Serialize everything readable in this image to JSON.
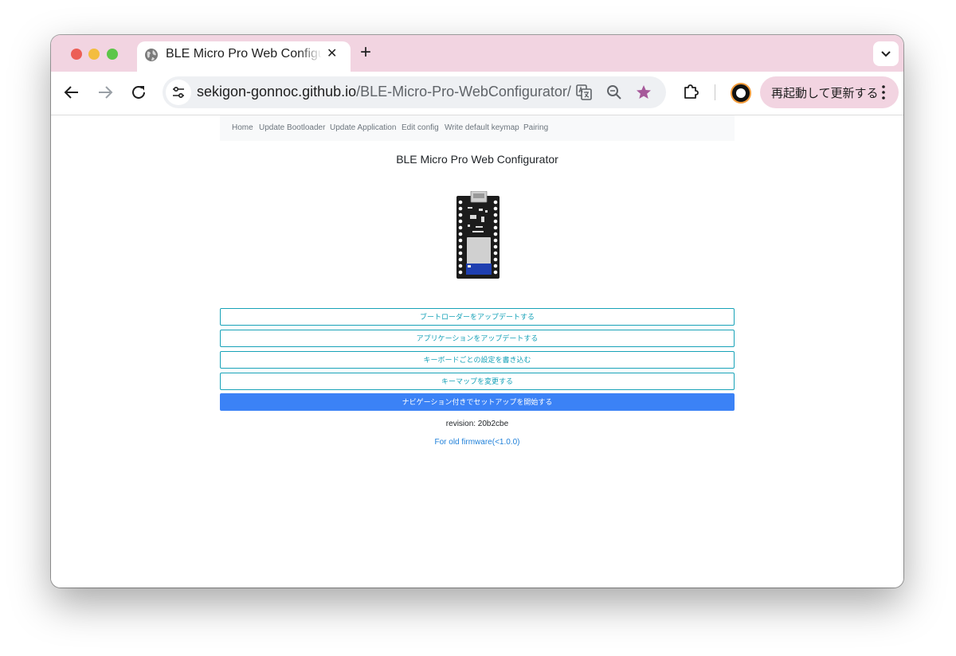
{
  "browser": {
    "tab_title": "BLE Micro Pro Web Configurator",
    "tab_close_glyph": "✕",
    "new_tab_glyph": "+",
    "url_host": "sekigon-gonnoc.github.io",
    "url_path": "/BLE-Micro-Pro-WebConfigurator/",
    "update_button_label": "再起動して更新する",
    "icons": [
      "globe-icon",
      "back-arrow-icon",
      "forward-arrow-icon",
      "reload-icon",
      "site-info-icon",
      "translate-icon",
      "zoom-icon",
      "bookmark-star-icon",
      "extensions-icon",
      "profile-avatar",
      "kebab-menu-icon",
      "chevron-down-icon"
    ],
    "colors": {
      "titlebar": "#f2d4e1",
      "omnibox": "#eef0f3",
      "star": "#a6599a"
    }
  },
  "page": {
    "nav": [
      "Home",
      "Update Bootloader",
      "Update Application",
      "Edit config",
      "Write default keymap",
      "Pairing"
    ],
    "title": "BLE Micro Pro Web Configurator",
    "buttons": [
      "ブートローダーをアップデートする",
      "アプリケーションをアップデートする",
      "キーボードごとの設定を書き込む",
      "キーマップを変更する",
      "ナビゲーション付きでセットアップを開始する"
    ],
    "revision": "revision: 20b2cbe",
    "old_firmware_link": "For old firmware(<1.0.0)",
    "colors": {
      "outline_button": "#17a2b8",
      "primary_button": "#3b82f6",
      "link": "#1d7fd9"
    }
  }
}
